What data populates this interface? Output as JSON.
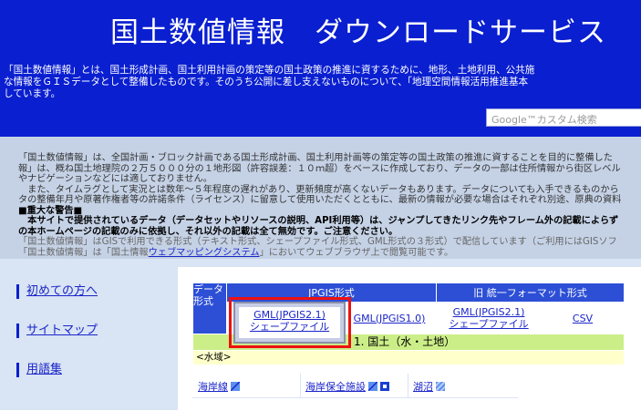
{
  "header": {
    "title": "国土数値情報　ダウンロードサービス",
    "description_line1": "「国土数値情報」とは、国土形成計画、国土利用計画の策定等の国土政策の推進に資するために、地形、土地利用、公共施",
    "description_line2": "な情報をＧＩＳデータとして整備したものです。そのうち公開に差し支えないものについて、「地理空間情報活用推進基本",
    "description_line3": "しています。",
    "search_placeholder": "Google™カスタム検索"
  },
  "notice": {
    "line1": "「国土数値情報」は、全国計画・ブロック計画である国土形成計画、国土利用計画等の策定等の国土政策の推進に資することを目的に整備した",
    "line2": "報」は、概ね国土地理院の２万５０００分の１地形図（許容誤差：１０ｍ超）をベースに作成しており、データの一部は住所情報から街区レベル",
    "line3": "やナビゲーションなどには適しておりません。",
    "line4": "　また、タイムラグとして実況とは数年～５年程度の遅れがあり、更新頻度が高くないデータもあります。データについても入手できるものから",
    "line5": "タの整備年月や原著作権者等の許諾条件（ライセンス）に留意して使用いただくとともに、最新の情報が必要な場合はそれぞれ別途、原典の資料",
    "warning_title": "■重大な警告■",
    "warning1": "　本サイトで提供されているデータ（データセットやリソースの説明、API利用等）は、ジャンプしてきたリンク先やフレーム外の記載によらず",
    "warning2": "の本ホームページの記載のみに依拠し、それ以外の記載は全て無効です。ご注意ください。",
    "line6": "「国土数値情報」はGISで利用できる形式（テキスト形式、シェープファイル形式、GML形式の３形式）で配信しています（ご利用にはGISソフ",
    "line7_pre": "「国土数値情報」は「国土情報",
    "line7_link": "ウェブマッピングシステム",
    "line7_post": "」においてウェブブラウザ上で閲覧可能です。"
  },
  "sidebar": {
    "items": [
      {
        "label": "初めての方へ"
      },
      {
        "label": "サイトマップ"
      },
      {
        "label": "用語集"
      }
    ]
  },
  "table": {
    "data_format_label": "データ形式",
    "jpgis_header": "JPGIS形式",
    "legacy_header": "旧 統一フォーマット形式",
    "formats": {
      "gml21_shape_line1": "GML(JPGIS2.1)",
      "gml21_shape_line2": "シェープファイル",
      "gml10": "GML(JPGIS1.0)",
      "legacy_gml21_line1": "GML(JPGIS2.1)",
      "legacy_gml21_line2": "シェープファイル",
      "csv": "CSV"
    },
    "category": "1. 国土（水・土地）",
    "subcategory": "<水域>",
    "items": [
      {
        "label": "海岸線",
        "icons": [
          "line-icon"
        ]
      },
      {
        "label": "海岸保全施設",
        "icons": [
          "line-icon",
          "point-icon"
        ]
      },
      {
        "label": "湖沼",
        "icons": [
          "area-icon"
        ]
      }
    ]
  },
  "colors": {
    "header_bg": "#0a1fd0",
    "notice_bg": "#c5d2e6",
    "body_bg": "#d9e4f4",
    "table_header": "#2d4fd6",
    "category_bg": "#ccee88",
    "subcategory_bg": "#ffffcc",
    "highlight": "#ee1111"
  }
}
